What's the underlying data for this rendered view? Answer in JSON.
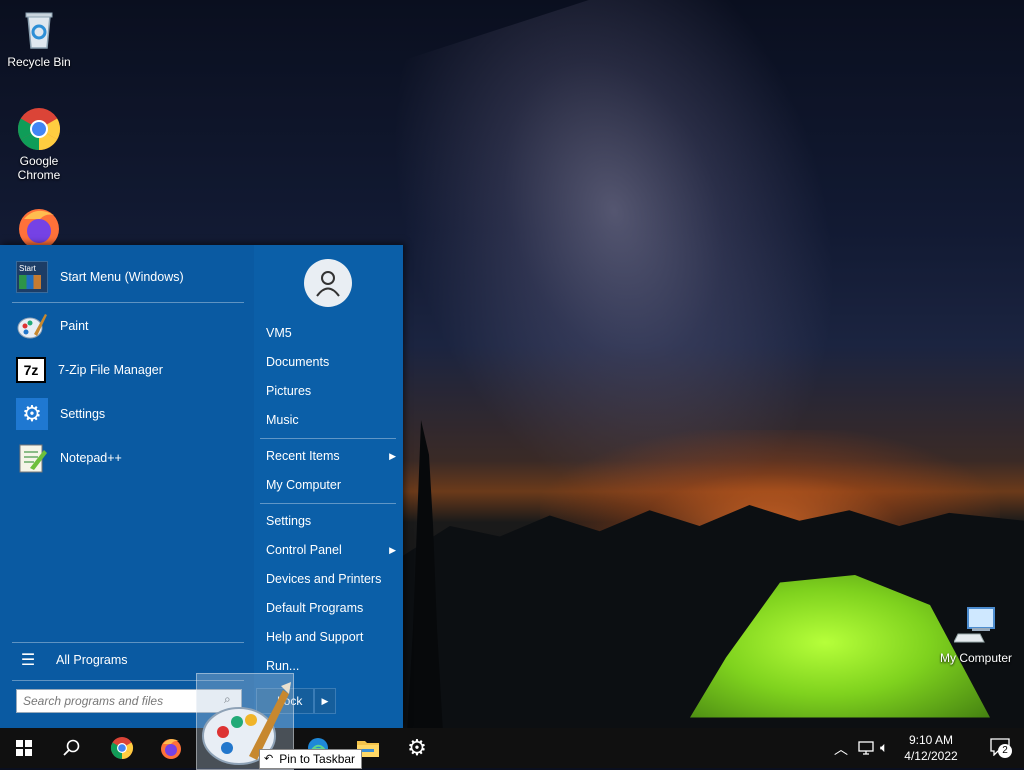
{
  "desktop": {
    "icons": [
      {
        "label": "Recycle Bin"
      },
      {
        "label": "Google Chrome"
      },
      {
        "label": "My Computer"
      }
    ]
  },
  "start_menu": {
    "pinned": [
      {
        "label": "Start Menu (Windows)",
        "icon": "start-menu-icon"
      },
      {
        "label": "Paint",
        "icon": "paint-icon"
      },
      {
        "label": "7-Zip File Manager",
        "icon": "7zip-icon"
      },
      {
        "label": "Settings",
        "icon": "gear-icon"
      },
      {
        "label": "Notepad++",
        "icon": "notepad-icon"
      }
    ],
    "all_programs": "All Programs",
    "search_placeholder": "Search programs and files",
    "right_items": [
      {
        "label": "VM5"
      },
      {
        "label": "Documents"
      },
      {
        "label": "Pictures"
      },
      {
        "label": "Music"
      },
      {
        "label": "Recent Items",
        "submenu": true
      },
      {
        "label": "My Computer"
      },
      {
        "label": "Settings"
      },
      {
        "label": "Control Panel",
        "submenu": true
      },
      {
        "label": "Devices and Printers"
      },
      {
        "label": "Default Programs"
      },
      {
        "label": "Help and Support"
      },
      {
        "label": "Run..."
      }
    ],
    "shutdown_label": "Lock",
    "start_tile_text": "Start"
  },
  "drag": {
    "tooltip": "Pin to Taskbar"
  },
  "taskbar": {
    "clock_time": "9:10 AM",
    "clock_date": "4/12/2022",
    "notification_count": "2"
  },
  "colors": {
    "start_menu_bg": "#0a5aa2",
    "taskbar_bg": "#101010",
    "tent_green": "#7fd21e"
  }
}
